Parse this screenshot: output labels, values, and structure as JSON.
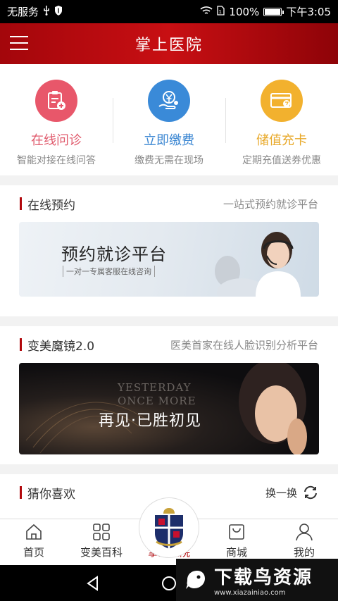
{
  "status_bar": {
    "carrier": "无服务",
    "battery": "100%",
    "time": "下午3:05"
  },
  "header": {
    "title": "掌上医院"
  },
  "quick_actions": [
    {
      "title": "在线问诊",
      "subtitle": "智能对接在线问答",
      "color": "#e8576a",
      "icon": "clipboard-icon"
    },
    {
      "title": "立即缴费",
      "subtitle": "缴费无需在现场",
      "color": "#3a8ad8",
      "icon": "yen-coin-icon"
    },
    {
      "title": "储值充卡",
      "subtitle": "定期充值送券优惠",
      "color": "#f2b12e",
      "icon": "card-icon"
    }
  ],
  "sections": {
    "booking": {
      "title": "在线预约",
      "desc": "一站式预约就诊平台",
      "banner_title": "预约就诊平台",
      "banner_sub": "一对一专属客服在线咨询"
    },
    "mirror": {
      "title": "变美魔镜2.0",
      "desc": "医美首家在线人脸识别分析平台",
      "banner_en1": "YESTERDAY",
      "banner_en2": "ONCE MORE",
      "banner_title": "再见·已胜初见"
    },
    "guess": {
      "title": "猜你喜欢",
      "refresh": "换一换"
    }
  },
  "tabs": [
    {
      "label": "首页",
      "icon": "home-icon"
    },
    {
      "label": "变美百科",
      "icon": "grid-icon"
    },
    {
      "label": "掌上医院",
      "icon": "hospital-logo"
    },
    {
      "label": "商城",
      "icon": "shopping-bag-icon"
    },
    {
      "label": "我的",
      "icon": "user-icon"
    }
  ],
  "watermark": {
    "text": "下载鸟资源",
    "url": "www.xiazainiao.com"
  }
}
